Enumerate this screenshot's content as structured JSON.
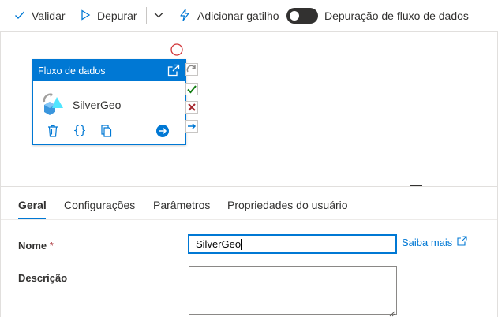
{
  "toolbar": {
    "validate_label": "Validar",
    "debug_label": "Depurar",
    "add_trigger_label": "Adicionar gatilho",
    "dataflow_debug_label": "Depuração de fluxo de dados",
    "dataflow_debug_on": false
  },
  "activity": {
    "type_label": "Fluxo de dados",
    "name": "SilverGeo"
  },
  "tabs": [
    {
      "label": "Geral",
      "active": true
    },
    {
      "label": "Configurações"
    },
    {
      "label": "Parâmetros"
    },
    {
      "label": "Propriedades do usuário"
    }
  ],
  "form": {
    "name_label": "Nome",
    "required_marker": "*",
    "name_value": "SilverGeo",
    "learn_more_label": "Saiba mais",
    "description_label": "Descrição",
    "description_value": ""
  },
  "colors": {
    "accent": "#0078d4",
    "success": "#107c10",
    "failure": "#a4262c",
    "required": "#a4262c"
  }
}
